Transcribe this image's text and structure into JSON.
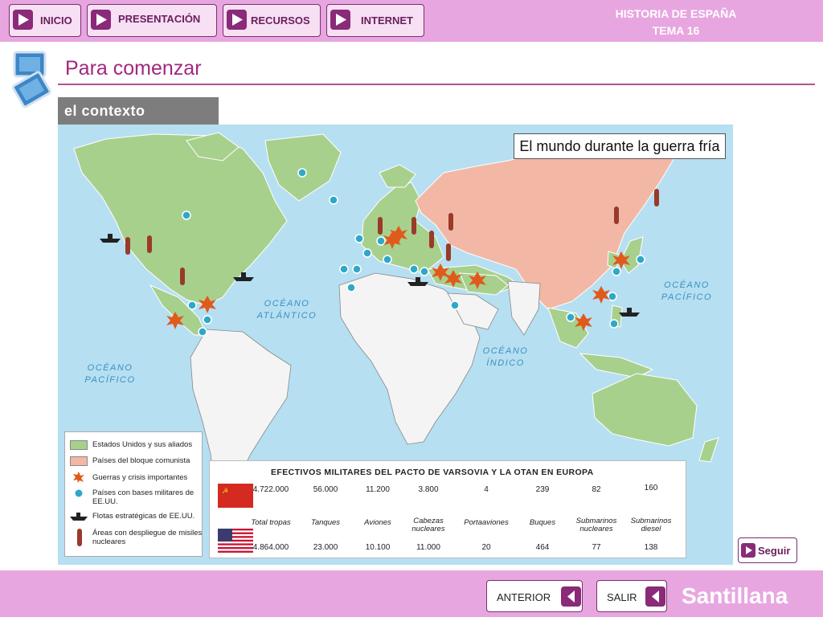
{
  "header": {
    "title_line1": "HISTORIA DE ESPAÑA",
    "title_line2": "TEMA 16",
    "nav": [
      {
        "label": "INICIO"
      },
      {
        "label": "PRESENTACIÓN"
      },
      {
        "label": "RECURSOS"
      },
      {
        "label": "INTERNET"
      }
    ]
  },
  "page": {
    "title": "Para comenzar",
    "section": "el contexto"
  },
  "map": {
    "title": "El mundo durante la guerra fría",
    "oceans": {
      "atlantic": "OCÉANO ATLÁNTICO",
      "pacific_left": "OCÉANO PACÍFICO",
      "pacific_right": "OCÉANO PACÍFICO",
      "indian": "OCÉANO ÍNDICO"
    },
    "legend": {
      "allies": "Estados Unidos y sus aliados",
      "communist": "Países del bloque comunista",
      "wars": "Guerras y crisis importantes",
      "bases": "Países con bases militares de EE.UU.",
      "fleets": "Flotas estratégicas de EE.UU.",
      "missiles": "Áreas con despliegue de misiles nucleares",
      "allies_color": "#a8d08d",
      "communist_color": "#f2b8a5"
    }
  },
  "table": {
    "title": "EFECTIVOS MILITARES DEL PACTO DE VARSOVIA Y LA OTAN EN EUROPA",
    "categories": [
      "Total tropas",
      "Tanques",
      "Aviones",
      "Cabezas nucleares",
      "Portaaviones",
      "Buques",
      "Submarinos nucleares",
      "Submarinos diesel"
    ],
    "warsaw": [
      "4.722.000",
      "56.000",
      "11.200",
      "3.800",
      "4",
      "239",
      "82",
      "160"
    ],
    "nato": [
      "4.864.000",
      "23.000",
      "10.100",
      "11.000",
      "20",
      "464",
      "77",
      "138"
    ]
  },
  "buttons": {
    "seguir": "Seguir",
    "anterior": "ANTERIOR",
    "salir": "SALIR"
  },
  "brand": "Santillana",
  "colors": {
    "bar": "#e8a6e0",
    "accent": "#8a2a78",
    "ocean": "#b6dff2"
  }
}
